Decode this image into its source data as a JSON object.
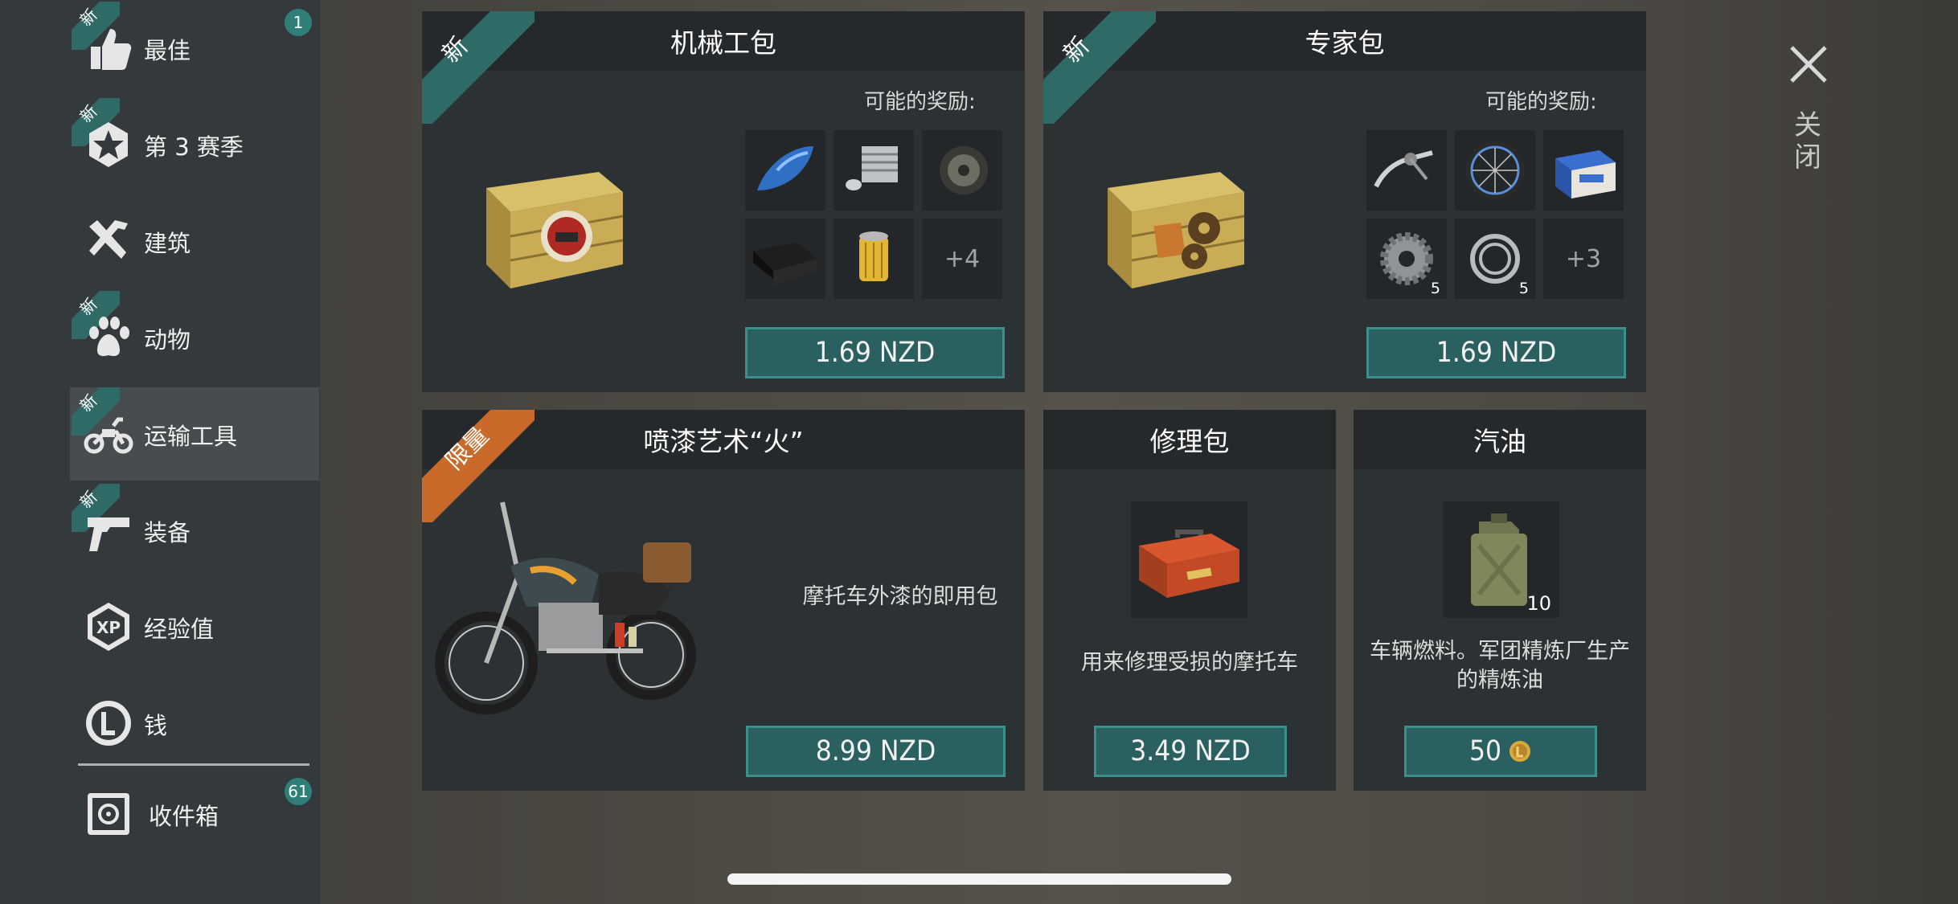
{
  "sidebar": {
    "items": [
      {
        "label": "最佳",
        "icon": "thumbs-up-icon",
        "new": true
      },
      {
        "label": "第 3 赛季",
        "icon": "star-badge-icon",
        "new": true
      },
      {
        "label": "建筑",
        "icon": "build-tools-icon",
        "new": false
      },
      {
        "label": "动物",
        "icon": "paw-icon",
        "new": true
      },
      {
        "label": "运输工具",
        "icon": "motorcycle-icon",
        "new": true,
        "active": true
      },
      {
        "label": "装备",
        "icon": "pistol-icon",
        "new": true
      },
      {
        "label": "经验值",
        "icon": "xp-icon",
        "new": false
      },
      {
        "label": "钱",
        "icon": "coin-icon",
        "new": false
      },
      {
        "label": "收件箱",
        "icon": "safe-icon",
        "new": false
      }
    ],
    "new_tag": "新",
    "best_badge": "1",
    "inbox_badge": "61"
  },
  "cards": {
    "mechanic": {
      "title": "机械工包",
      "tag": "新",
      "rewards_label": "可能的奖励:",
      "more": "+4",
      "price": "1.69 NZD"
    },
    "expert": {
      "title": "专家包",
      "tag": "新",
      "rewards_label": "可能的奖励:",
      "more": "+3",
      "qty_gear": "5",
      "qty_bearing": "5",
      "price": "1.69 NZD"
    },
    "paint": {
      "title": "喷漆艺术“火”",
      "tag": "限量",
      "description": "摩托车外漆的即用包",
      "price": "8.99 NZD"
    },
    "repair": {
      "title": "修理包",
      "description": "用来修理受损的摩托车",
      "price": "3.49 NZD"
    },
    "fuel": {
      "title": "汽油",
      "description": "车辆燃料。军团精炼厂生产的精炼油",
      "qty": "10",
      "price": "50"
    }
  },
  "close": {
    "label": "关闭"
  },
  "colors": {
    "teal": "#2f6a66",
    "orange": "#c96a2a",
    "button": "#2a6160"
  }
}
